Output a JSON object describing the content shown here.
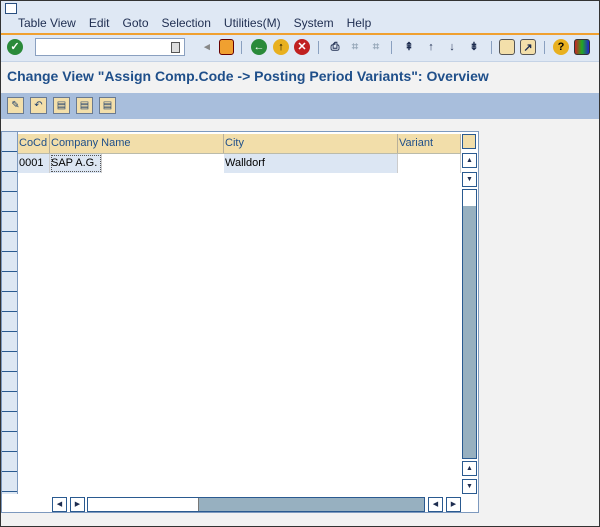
{
  "menu": [
    "Table View",
    "Edit",
    "Goto",
    "Selection",
    "Utilities(M)",
    "System",
    "Help"
  ],
  "command_field": {
    "value": ""
  },
  "toolbar_icons": [
    "enter-icon",
    "back-arrow-icon",
    "save-icon",
    "back-icon",
    "exit-icon",
    "cancel-icon",
    "print-icon",
    "find-icon",
    "find-next-icon",
    "first-page-icon",
    "previous-page-icon",
    "next-page-icon",
    "last-page-icon",
    "create-session-icon",
    "shortcut-icon",
    "help-icon",
    "layout-icon"
  ],
  "title": "Change View \"Assign Comp.Code -> Posting Period Variants\": Overview",
  "app_toolbar_icons": [
    "display-change-icon",
    "undo-icon",
    "select-all-icon",
    "select-block-icon",
    "deselect-all-icon"
  ],
  "table": {
    "columns": [
      "CoCd",
      "Company Name",
      "City",
      "Variant"
    ],
    "rows": [
      [
        "0001",
        "SAP A.G.",
        "Walldorf",
        ""
      ]
    ]
  },
  "colors": {
    "accent": "#1f4f8a",
    "header": "#f2deaa",
    "menu_line": "#f0a030"
  }
}
